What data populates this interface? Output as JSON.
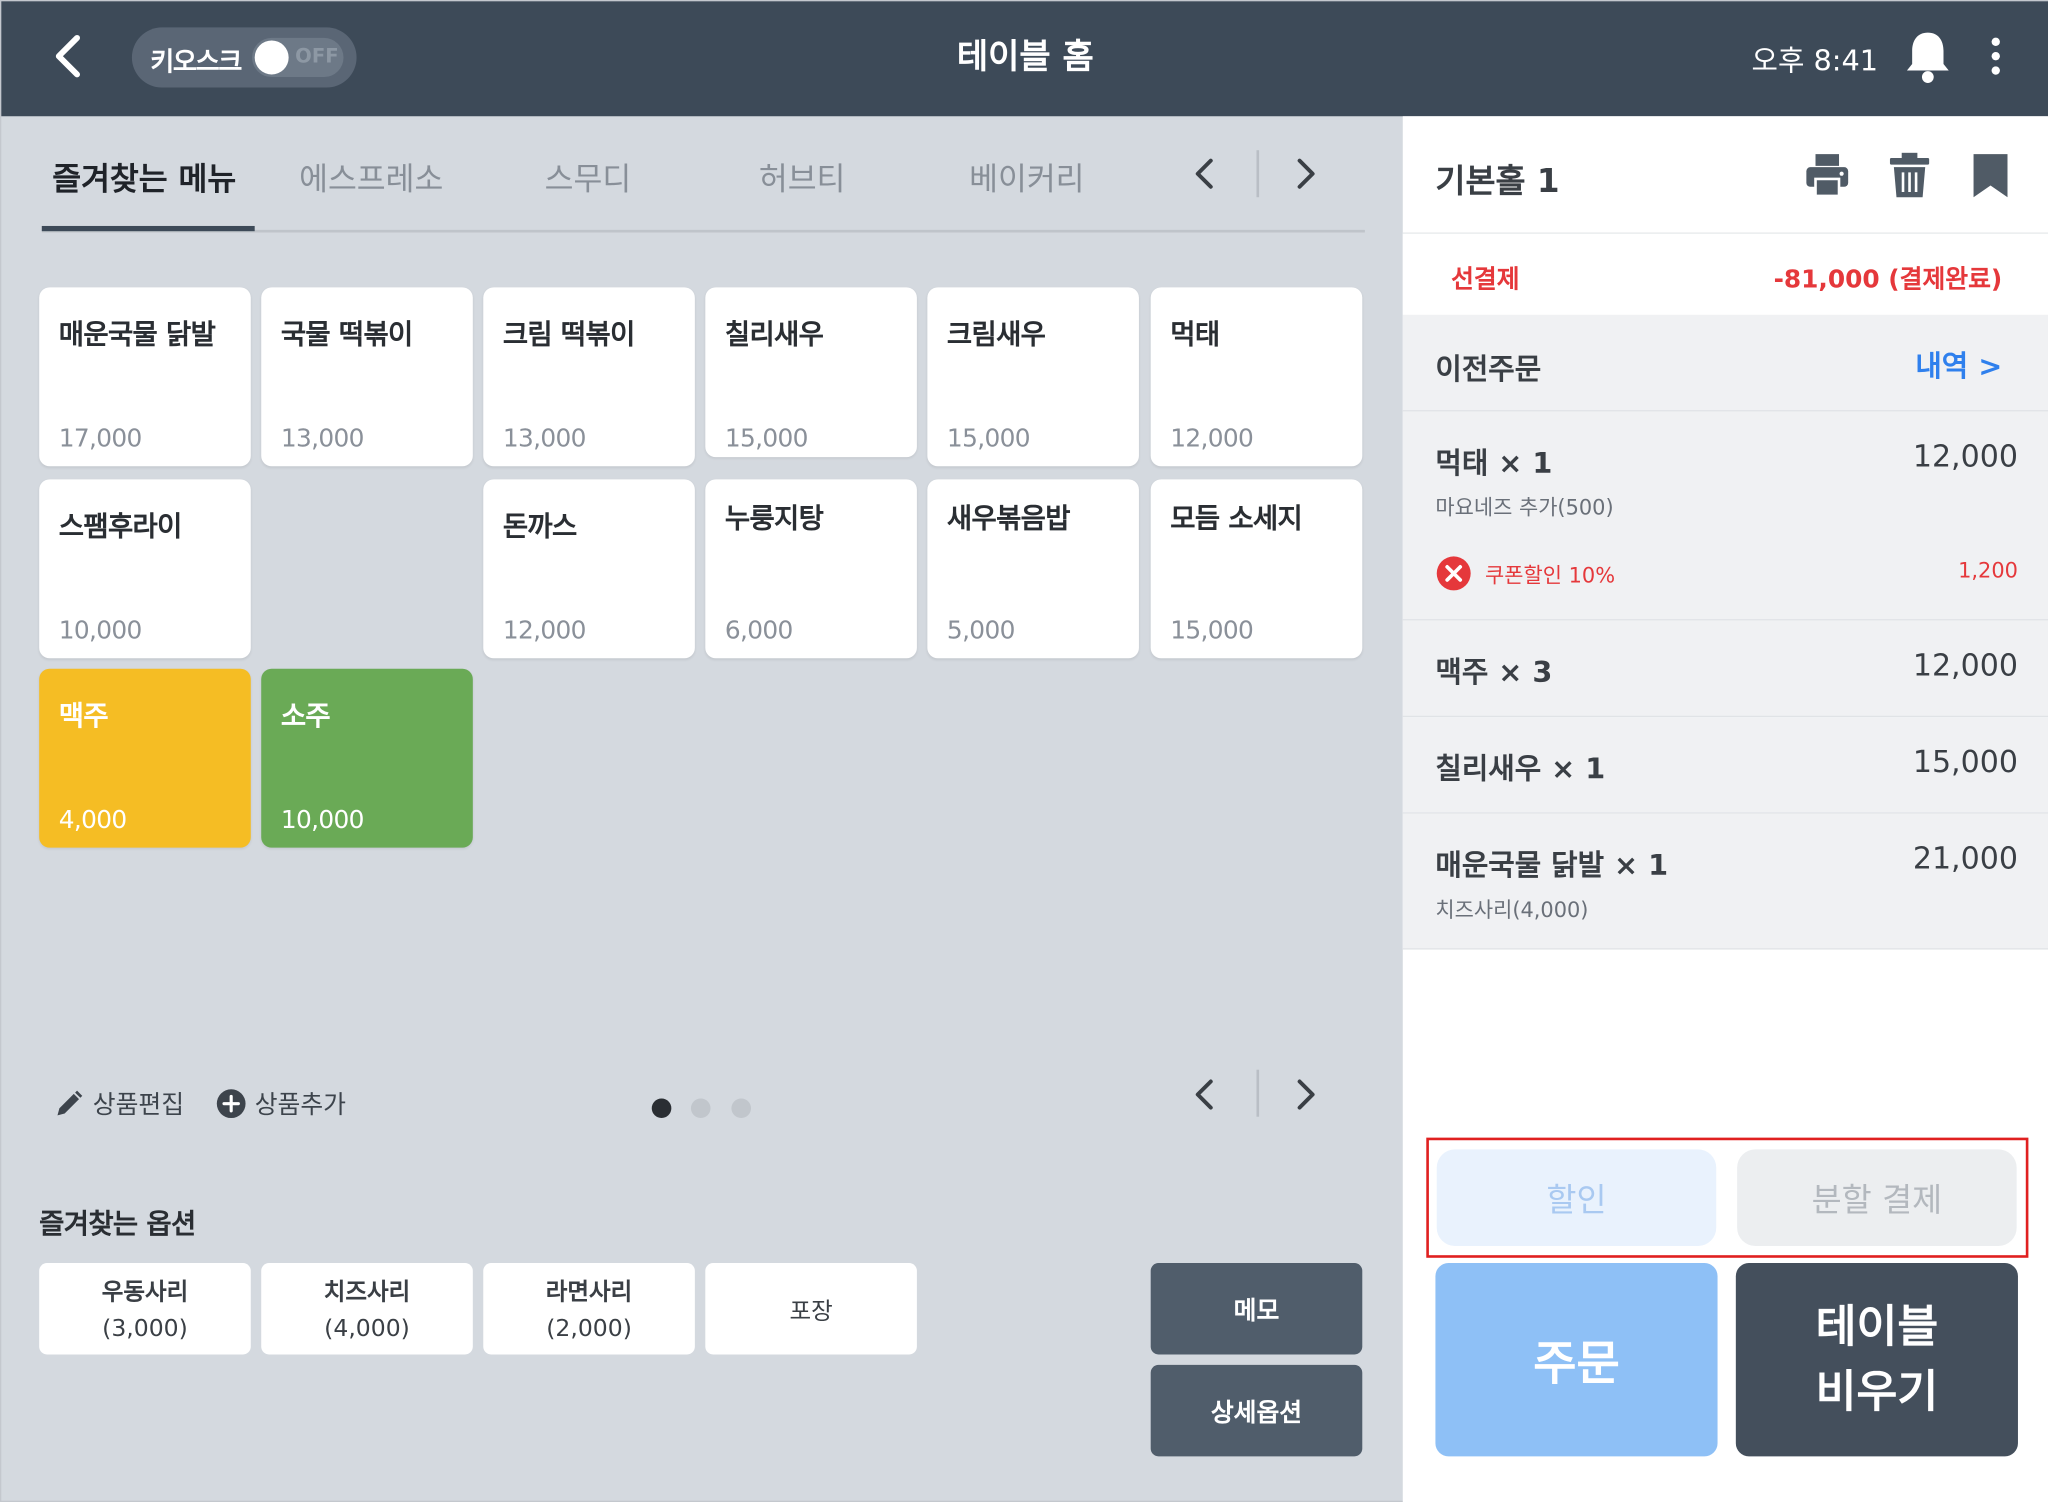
{
  "header": {
    "title": "테이블 홈",
    "kiosk_label": "키오스크",
    "kiosk_state": "OFF",
    "time": "오후 8:41"
  },
  "tabs": [
    {
      "label": "즐겨찾는 메뉴",
      "active": true
    },
    {
      "label": "에스프레소",
      "active": false
    },
    {
      "label": "스무디",
      "active": false
    },
    {
      "label": "허브티",
      "active": false
    },
    {
      "label": "베이커리",
      "active": false
    }
  ],
  "menu": [
    {
      "name": "매운국물 닭발",
      "price": "17,000"
    },
    {
      "name": "국물 떡볶이",
      "price": "13,000"
    },
    {
      "name": "크림 떡볶이",
      "price": "13,000"
    },
    {
      "name": "칠리새우",
      "price": "15,000"
    },
    {
      "name": "크림새우",
      "price": "15,000"
    },
    {
      "name": "먹태",
      "price": "12,000"
    },
    {
      "name": "스팸후라이",
      "price": "10,000"
    },
    {
      "name": "돈까스",
      "price": "12,000"
    },
    {
      "name": "누룽지탕",
      "price": "6,000"
    },
    {
      "name": "새우볶음밥",
      "price": "5,000"
    },
    {
      "name": "모듬 소세지",
      "price": "15,000"
    },
    {
      "name": "맥주",
      "price": "4,000",
      "color": "#f5bd24"
    },
    {
      "name": "소주",
      "price": "10,000",
      "color": "#6aaa56"
    }
  ],
  "tools": {
    "edit_label": "상품편집",
    "add_label": "상품추가",
    "page_count": 3,
    "current_page": 1
  },
  "options": {
    "title": "즐겨찾는 옵션",
    "items": [
      {
        "name": "우동사리",
        "price": "(3,000)"
      },
      {
        "name": "치즈사리",
        "price": "(4,000)"
      },
      {
        "name": "라면사리",
        "price": "(2,000)"
      },
      {
        "name": "포장",
        "price": ""
      }
    ],
    "memo_label": "메모",
    "detail_label": "상세옵션"
  },
  "panel": {
    "table_name": "기본홀 1",
    "prepay_label": "선결제",
    "prepay_value": "-81,000 (결제완료)",
    "prev_label": "이전주문",
    "history_label": "내역 >",
    "orders": [
      {
        "name": "먹태 × 1",
        "price": "12,000",
        "sub": "마요네즈 추가(500)",
        "coupon": "쿠폰할인 10%",
        "discount": "1,200"
      },
      {
        "name": "맥주 × 3",
        "price": "12,000"
      },
      {
        "name": "칠리새우 × 1",
        "price": "15,000"
      },
      {
        "name": "매운국물 닭발 × 1",
        "price": "21,000",
        "sub": "치즈사리(4,000)"
      }
    ],
    "discount_label": "할인",
    "split_label": "분할 결제",
    "order_label": "주문",
    "clear_label": "테이블\n비우기"
  },
  "colors": {
    "header_bg": "#3d4a58",
    "accent_blue": "#2f80ed",
    "danger_red": "#e5383b",
    "beer_yellow": "#f5bd24",
    "soju_green": "#6aaa56"
  }
}
